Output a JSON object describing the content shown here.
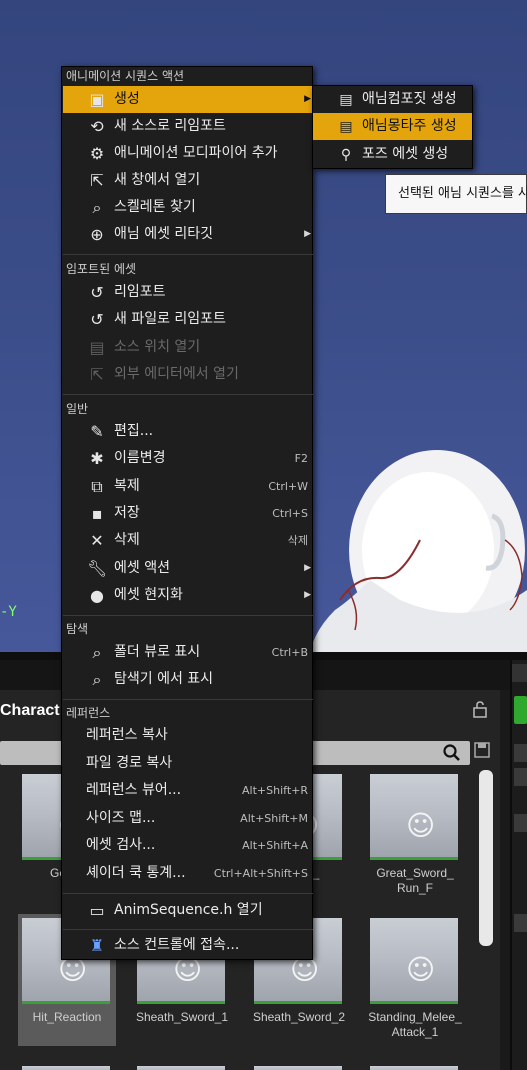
{
  "viewport": {
    "axis_label": "-Y"
  },
  "menu": {
    "sections": {
      "anim": "애니메이션 시퀀스 액션",
      "imported": "임포트된 에셋",
      "common": "일반",
      "explore": "탐색",
      "references": "레퍼런스"
    },
    "anim_items": [
      {
        "label": "생성",
        "icon": "create-icon",
        "submenu": true,
        "highlighted": true
      },
      {
        "label": "새 소스로 리임포트",
        "icon": "reimport-source-icon"
      },
      {
        "label": "애니메이션 모디파이어 추가",
        "icon": "modifier-icon"
      },
      {
        "label": "새 창에서 열기",
        "icon": "open-window-icon"
      },
      {
        "label": "스켈레톤 찾기",
        "icon": "find-skeleton-icon"
      },
      {
        "label": "애님 에셋 리타깃",
        "icon": "retarget-icon",
        "submenu": true
      }
    ],
    "imported_items": [
      {
        "label": "리임포트",
        "icon": "reimport-icon"
      },
      {
        "label": "새 파일로 리임포트",
        "icon": "reimport-file-icon"
      },
      {
        "label": "소스 위치 열기",
        "icon": "source-location-icon",
        "disabled": true
      },
      {
        "label": "외부 에디터에서 열기",
        "icon": "external-editor-icon",
        "disabled": true
      }
    ],
    "common_items": [
      {
        "label": "편집...",
        "icon": "edit-icon"
      },
      {
        "label": "이름변경",
        "icon": "rename-icon",
        "shortcut": "F2"
      },
      {
        "label": "복제",
        "icon": "duplicate-icon",
        "shortcut": "Ctrl+W"
      },
      {
        "label": "저장",
        "icon": "save-icon",
        "shortcut": "Ctrl+S"
      },
      {
        "label": "삭제",
        "icon": "delete-icon",
        "shortcut": "삭제"
      },
      {
        "label": "에셋 액션",
        "icon": "asset-actions-icon",
        "submenu": true
      },
      {
        "label": "에셋 현지화",
        "icon": "localize-icon",
        "submenu": true
      }
    ],
    "explore_items": [
      {
        "label": "폴더 뷰로 표시",
        "icon": "folder-view-icon",
        "shortcut": "Ctrl+B"
      },
      {
        "label": "탐색기 에서 표시",
        "icon": "explorer-icon"
      }
    ],
    "reference_items": [
      {
        "label": "레퍼런스 복사"
      },
      {
        "label": "파일 경로 복사"
      },
      {
        "label": "레퍼런스 뷰어...",
        "shortcut": "Alt+Shift+R"
      },
      {
        "label": "사이즈 맵...",
        "shortcut": "Alt+Shift+M"
      },
      {
        "label": "에셋 검사...",
        "shortcut": "Alt+Shift+A"
      },
      {
        "label": "셰이더 쿡 통계...",
        "shortcut": "Ctrl+Alt+Shift+S"
      }
    ],
    "header_file_item": {
      "label": "AnimSequence.h 열기",
      "icon": "cpp-header-icon"
    },
    "source_control_item": {
      "label": "소스 컨트롤에 접속...",
      "icon": "source-control-icon"
    }
  },
  "submenu": {
    "items": [
      {
        "label": "애님컴포짓 생성",
        "icon": "anim-composite-icon"
      },
      {
        "label": "애님몽타주 생성",
        "icon": "anim-montage-icon",
        "highlighted": true
      },
      {
        "label": "포즈 에셋 생성",
        "icon": "pose-asset-icon"
      }
    ]
  },
  "tooltip": {
    "text": "선택된 애님 시퀀스를 사"
  },
  "content_browser": {
    "header": "Charact",
    "assets_row1": [
      {
        "name": "GetHit"
      },
      {
        "name": ""
      },
      {
        "name": "Sword_\nB"
      },
      {
        "name": "Great_Sword_\nRun_F"
      }
    ],
    "assets_row2": [
      {
        "name": "Hit_Reaction",
        "selected": true
      },
      {
        "name": "Sheath_Sword_1"
      },
      {
        "name": "Sheath_Sword_2"
      },
      {
        "name": "Standing_Melee_\nAttack_1"
      }
    ]
  }
}
